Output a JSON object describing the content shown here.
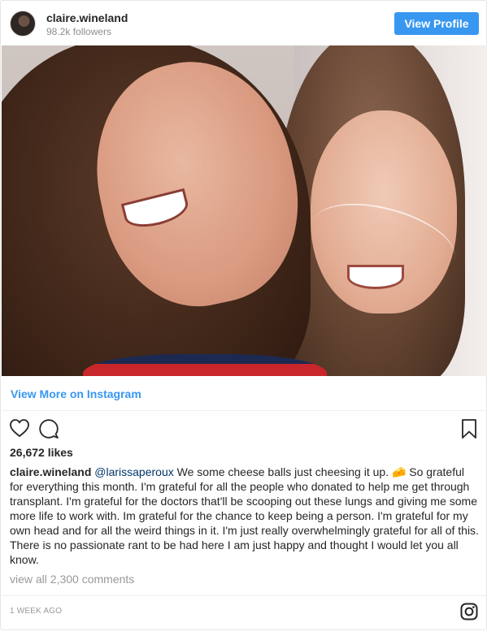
{
  "header": {
    "username": "claire.wineland",
    "followers": "98.2k followers",
    "view_profile_label": "View Profile"
  },
  "post": {
    "view_more_label": "View More on Instagram",
    "likes": "26,672 likes",
    "caption": {
      "username": "claire.wineland",
      "mention": "@larissaperoux",
      "text": " We some cheese balls just cheesing it up. 🧀 So grateful for everything this month. I'm grateful for all the people who donated to help me get through transplant. I'm grateful for the doctors that'll be scooping out these lungs and giving me some more life to work with. Im grateful for the chance to keep being a person. I'm grateful for my own head and for all the weird things in it. I'm just really overwhelmingly grateful for all of this. There is no passionate rant to be had here I am just happy and thought I would let you all know."
    },
    "comments_label": "view all 2,300 comments",
    "timestamp": "1 WEEK AGO"
  },
  "icons": {
    "like": "heart-icon",
    "comment": "comment-icon",
    "save": "bookmark-icon",
    "brand": "instagram-icon"
  },
  "colors": {
    "accent": "#3897f0",
    "mention": "#003569",
    "muted": "#999999"
  }
}
